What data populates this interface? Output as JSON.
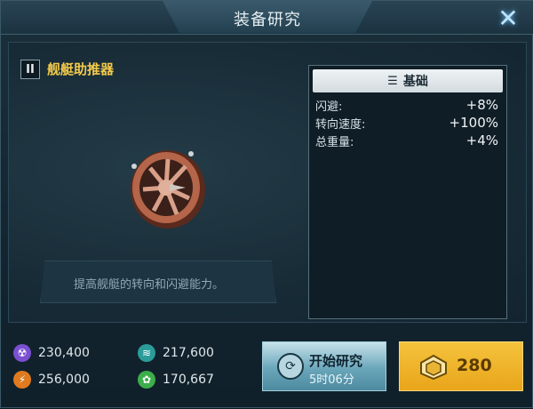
{
  "window": {
    "title": "装备研究",
    "close_icon": "close-icon"
  },
  "item": {
    "level": "II",
    "name": "舰艇助推器",
    "description": "提高舰艇的转向和闪避能力。"
  },
  "stats": {
    "header": "基础",
    "header_icon": "list-icon",
    "rows": [
      {
        "label": "闪避:",
        "value": "+8%"
      },
      {
        "label": "转向速度:",
        "value": "+100%"
      },
      {
        "label": "总重量:",
        "value": "+4%"
      }
    ]
  },
  "resources": [
    {
      "icon": "radiation-icon",
      "value": "230,400",
      "color": "#7a4fd0"
    },
    {
      "icon": "layers-icon",
      "value": "217,600",
      "color": "#2a9d9a"
    },
    {
      "icon": "energy-icon",
      "value": "256,000",
      "color": "#e07a1f"
    },
    {
      "icon": "leaf-icon",
      "value": "170,667",
      "color": "#3cae4a"
    }
  ],
  "actions": {
    "research_label": "开始研究",
    "research_time": "5时06分",
    "gold_cost": "280"
  }
}
